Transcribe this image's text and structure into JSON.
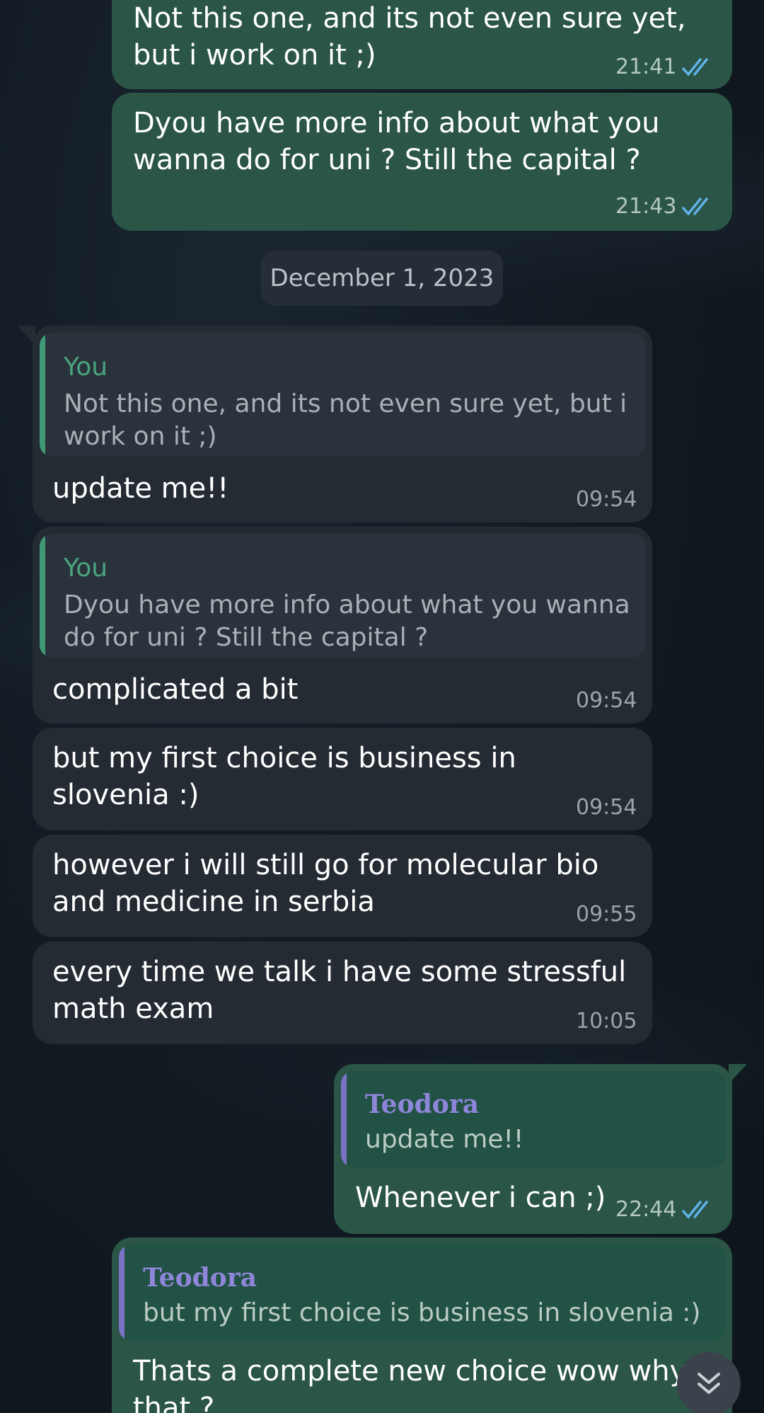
{
  "messages": [
    {
      "id": "m1",
      "direction": "out",
      "lines": "Not this one, and its not even sure yet,\nbut i work on it ;)",
      "time": "21:41"
    },
    {
      "id": "m2",
      "direction": "out",
      "lines": "Dyou have more info about what you\nwanna do for uni ? Still the capital ?",
      "time": "21:43"
    },
    {
      "id": "m3",
      "direction": "in",
      "reply": {
        "author": "You",
        "text": "Not this one, and its not even sure yet, but i\nwork on it ;)"
      },
      "lines": "update me!!",
      "time": "09:54"
    },
    {
      "id": "m4",
      "direction": "in",
      "reply": {
        "author": "You",
        "text": "Dyou have more info about what you wanna\ndo for uni ? Still the capital ?"
      },
      "lines": "complicated a bit",
      "time": "09:54"
    },
    {
      "id": "m5",
      "direction": "in",
      "lines": "but my first choice is business in\nslovenia :)",
      "time": "09:54"
    },
    {
      "id": "m6",
      "direction": "in",
      "lines": "however i will still go for molecular bio\nand medicine in serbia",
      "time": "09:55"
    },
    {
      "id": "m7",
      "direction": "in",
      "lines": "every time we talk i have some stressful\nmath exam",
      "time": "10:05"
    },
    {
      "id": "m8",
      "direction": "out",
      "reply": {
        "author": "Teodora",
        "text": "update me!!"
      },
      "lines": "Whenever i can ;)",
      "time": "22:44"
    },
    {
      "id": "m9",
      "direction": "out",
      "reply": {
        "author": "Teodora",
        "text": "but my first choice is business in slovenia :)"
      },
      "lines": "Thats a complete new choice wow why\nthat ?"
    }
  ],
  "date_separator": "December 1, 2023",
  "icons": {
    "read_ticks": "double-check-icon",
    "scroll_down": "chevrons-down-icon"
  },
  "colors": {
    "outgoing": "#2a5547",
    "incoming": "#242b33",
    "tick": "#5fb3e8",
    "reply_you": "#4aa37f",
    "reply_teodora": "#8f86da"
  }
}
